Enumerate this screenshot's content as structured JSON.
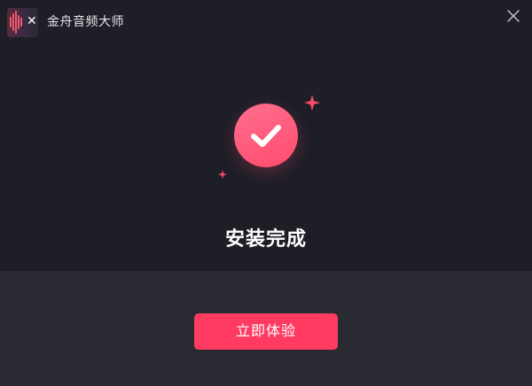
{
  "window": {
    "title": "金舟音频大师",
    "logo_icon": "audio-waveform-scissors-icon",
    "close_icon": "close-icon"
  },
  "main": {
    "status_icon": "check-circle-icon",
    "headline": "安装完成"
  },
  "footer": {
    "cta_label": "立即体验"
  },
  "colors": {
    "background": "#1e1e27",
    "footer_background": "#2a2a33",
    "accent": "#ff3b62",
    "check_circle": "#ff5a7a"
  }
}
